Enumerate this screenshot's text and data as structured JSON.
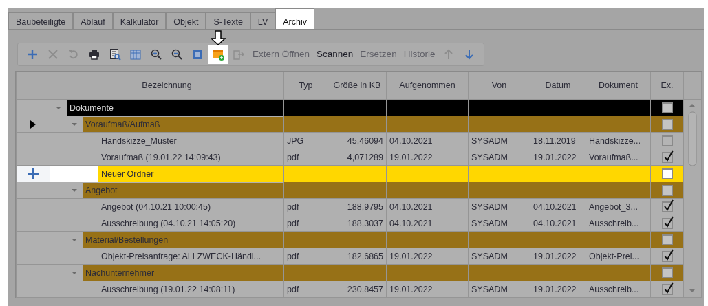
{
  "tabs": [
    {
      "label": "Baubeteiligte",
      "selected": false
    },
    {
      "label": "Ablauf",
      "selected": false
    },
    {
      "label": "Kalkulator",
      "selected": false
    },
    {
      "label": "Objekt",
      "selected": false
    },
    {
      "label": "S-Texte",
      "selected": false
    },
    {
      "label": "LV",
      "selected": false
    },
    {
      "label": "Archiv",
      "selected": true
    }
  ],
  "toolbar": [
    {
      "kind": "plus",
      "disabled": false
    },
    {
      "kind": "delete",
      "disabled": true
    },
    {
      "kind": "undo",
      "disabled": true
    },
    {
      "kind": "print",
      "disabled": false
    },
    {
      "kind": "report",
      "disabled": false
    },
    {
      "kind": "columns",
      "disabled": false
    },
    {
      "kind": "zoom-in",
      "disabled": false
    },
    {
      "kind": "zoom-out",
      "disabled": false
    },
    {
      "kind": "help",
      "disabled": false
    },
    {
      "kind": "new-folder",
      "disabled": false,
      "highlighted": true
    },
    {
      "kind": "export",
      "disabled": true
    },
    {
      "kind": "text",
      "label": "Extern Öffnen",
      "disabled": true
    },
    {
      "kind": "text",
      "label": "Scannen",
      "disabled": false
    },
    {
      "kind": "text",
      "label": "Ersetzen",
      "disabled": true
    },
    {
      "kind": "text",
      "label": "Historie",
      "disabled": true
    },
    {
      "kind": "up",
      "disabled": true
    },
    {
      "kind": "down",
      "disabled": false
    }
  ],
  "table": {
    "columns": [
      "Bezeichnung",
      "Typ",
      "Größe in KB",
      "Aufgenommen",
      "Von",
      "Datum",
      "Dokument",
      "Ex."
    ],
    "rows": [
      {
        "name": "Dokumente",
        "color": "#000000",
        "expanded": true,
        "ex": false,
        "children": [
          {
            "name": "Voraufmaß/Aufmaß",
            "color": "#977117",
            "expanded": true,
            "current": true,
            "ex": false,
            "children": [
              {
                "name": "Handskizze_Muster",
                "type": "JPG",
                "size": "45,46094",
                "added": "04.10.2021",
                "by": "SYSADM",
                "date": "18.11.2019",
                "document": "Handskizze...",
                "ex": false
              },
              {
                "name": "Voraufmaß (19.01.22 14:09:43)",
                "type": "pdf",
                "size": "4,071289",
                "added": "19.01.2022",
                "by": "SYSADM",
                "date": "19.01.2022",
                "document": "Voraufmaß...",
                "ex": true
              },
              {
                "name": "Neuer Ordner",
                "color": "#ffd700",
                "new": true,
                "highlighted": true,
                "ex": false
              }
            ]
          },
          {
            "name": "Angebot",
            "color": "#977117",
            "expanded": true,
            "ex": false,
            "children": [
              {
                "name": "Angebot (04.10.21 10:00:45)",
                "type": "pdf",
                "size": "188,9795",
                "added": "04.10.2021",
                "by": "SYSADM",
                "date": "04.10.2021",
                "document": "Angebot_3...",
                "ex": true
              },
              {
                "name": "Ausschreibung (04.10.21 14:05:20)",
                "type": "pdf",
                "size": "188,3037",
                "added": "04.10.2021",
                "by": "SYSADM",
                "date": "04.10.2021",
                "document": "Ausschreib...",
                "ex": true
              }
            ]
          },
          {
            "name": "Material/Bestellungen",
            "color": "#977117",
            "expanded": true,
            "ex": false,
            "children": [
              {
                "name": "Objekt-Preisanfrage: ALLZWECK-Händl...",
                "type": "pdf",
                "size": "182,6865",
                "added": "19.01.2022",
                "by": "SYSADM",
                "date": "19.01.2022",
                "document": "Objekt-Prei...",
                "ex": true
              }
            ]
          },
          {
            "name": "Nachunternehmer",
            "color": "#977117",
            "expanded": true,
            "ex": false,
            "children": [
              {
                "name": "Ausschreibung (19.01.22 14:08:11)",
                "type": "pdf",
                "size": "230,8457",
                "added": "19.01.2022",
                "by": "SYSADM",
                "date": "19.01.2022",
                "document": "Ausschreib...",
                "ex": true
              }
            ]
          }
        ]
      }
    ]
  }
}
